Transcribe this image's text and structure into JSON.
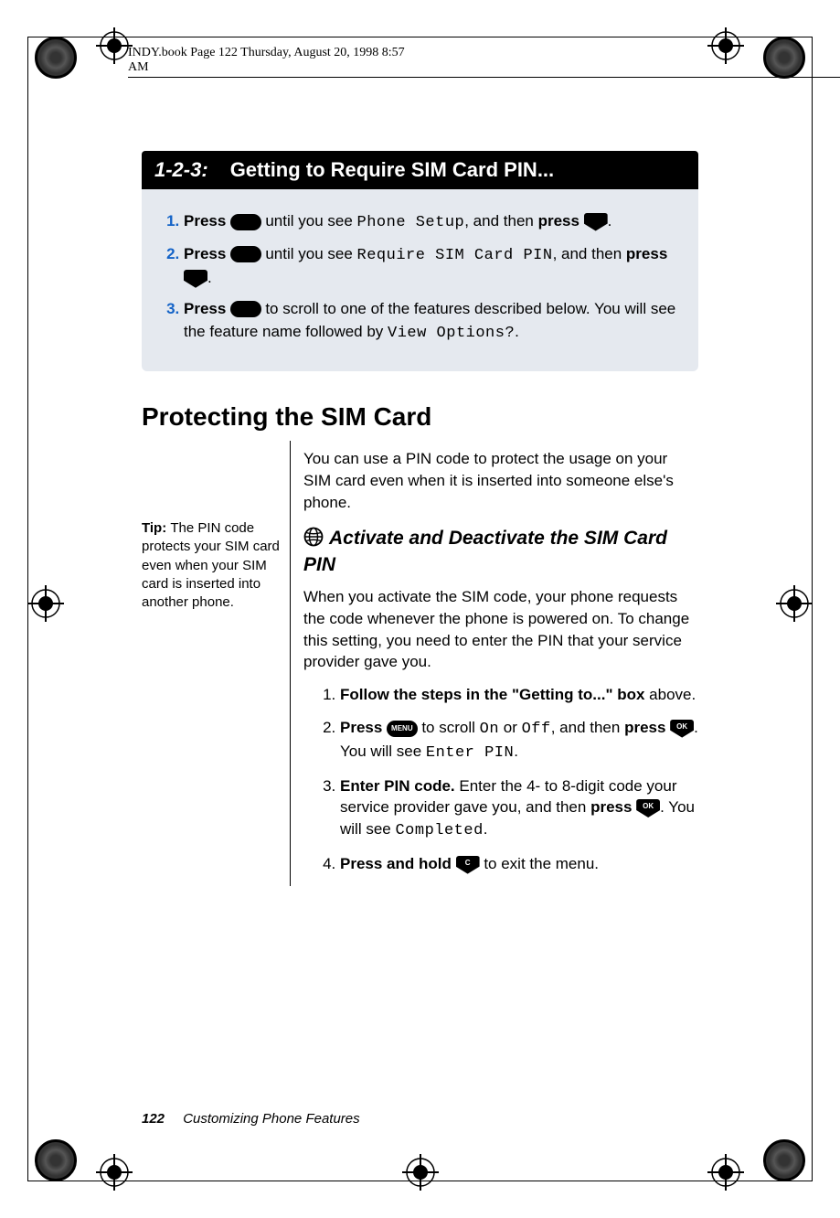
{
  "meta": {
    "header_text": "INDY.book  Page 122  Thursday, August 20, 1998  8:57 AM"
  },
  "header_box": {
    "prefix": "1-2-3:",
    "title": "Getting to Require SIM Card PIN..."
  },
  "blue_steps": [
    {
      "pre": "Press ",
      "btn1": "MENU",
      "mid1": " until you see ",
      "lcd1": "Phone Setup",
      "mid2": ", and then ",
      "bold2": "press ",
      "btn2": "OK",
      "end": "."
    },
    {
      "pre": "Press ",
      "btn1": "MENU",
      "mid1": " until you see ",
      "lcd1": "Require SIM Card PIN",
      "mid2": ", and then ",
      "bold2": "press ",
      "btn2": "OK",
      "end": "."
    },
    {
      "pre": "Press ",
      "btn1": "MENU",
      "mid1": " to scroll to one of the features described below. You will see the feature name followed by ",
      "lcd1": "View Options?",
      "end": "."
    }
  ],
  "section_title": "Protecting the SIM Card",
  "tip": {
    "label": "Tip: ",
    "text": "The PIN code protects your SIM card even when your SIM card is inserted into another phone."
  },
  "intro_para": "You can use a PIN code to protect the usage on your SIM card even when it is inserted into someone else's phone.",
  "sub_heading": "Activate and Deactivate the SIM Card PIN",
  "sub_para": "When you activate the SIM code, your phone requests the code whenever the phone is powered on. To change this setting, you need to enter the PIN that your service provider gave you.",
  "steps": [
    {
      "bold": "Follow the steps in the \"Getting to...\" box",
      "rest": " above."
    },
    {
      "bold": "Press ",
      "btn1": "MENU",
      "mid1": " to scroll ",
      "lcd1": "On",
      "mid2": " or ",
      "lcd2": "Off",
      "mid3": ", and then ",
      "bold2": "press ",
      "btn2": "OK",
      "mid4": ". You will see ",
      "lcd3": "Enter PIN",
      "end": "."
    },
    {
      "bold": "Enter PIN code.",
      "mid1": " Enter the 4- to 8-digit code your service provider gave you, and then ",
      "bold2": "press ",
      "btn2": "OK",
      "mid4": ". You will see ",
      "lcd3": "Completed",
      "end": "."
    },
    {
      "bold": "Press and hold ",
      "btn1": "C",
      "mid1": " to exit the menu."
    }
  ],
  "footer": {
    "page": "122",
    "chapter": "Customizing Phone Features"
  },
  "icons": {
    "menu": "MENU",
    "ok": "OK",
    "c": "C"
  }
}
